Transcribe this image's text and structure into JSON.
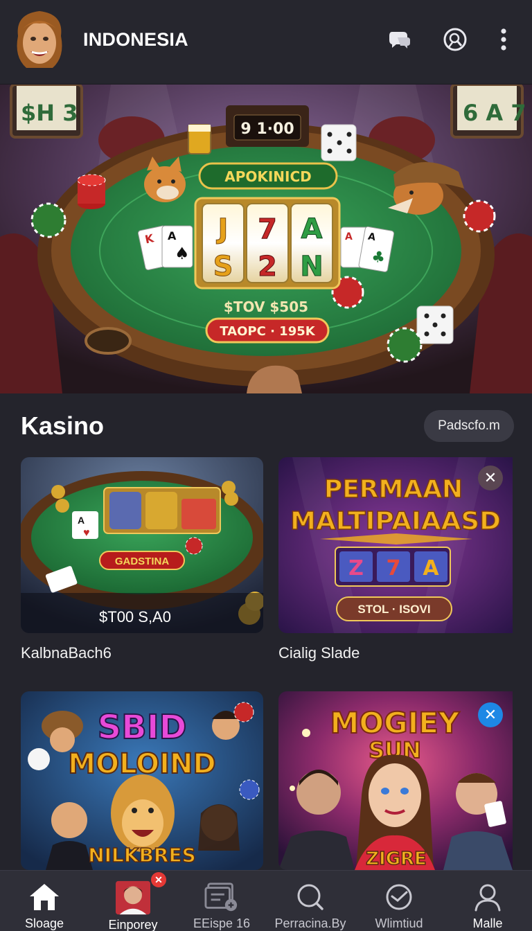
{
  "header": {
    "title": "INDONESIA",
    "icons": [
      "chat-icon",
      "search-icon",
      "more-vertical-icon"
    ]
  },
  "hero": {
    "timer": "9 1·00",
    "banner": "APOKINICD",
    "reels": [
      "J",
      "7",
      "A",
      "S",
      "2",
      "N"
    ],
    "pot_text": "$TOV  $505",
    "button": "TAOPC · 195K",
    "sign_left": "$H 3",
    "sign_right": "6 A 7"
  },
  "section": {
    "title": "Kasino",
    "pill": "Padscfo.m"
  },
  "cards": [
    {
      "title": "KalbnaBach6",
      "banner": "GADSTINA",
      "value": "$T00 S,A0"
    },
    {
      "title": "Cialig Slade",
      "headline_1": "PERMAAN",
      "headline_2": "MALTIPAIAASD",
      "reels": [
        "Z",
        "7",
        "A"
      ],
      "button": "STOL · ISOVI",
      "close": "✕"
    },
    {
      "headline_1": "SBID",
      "headline_2": "MOLOIND",
      "footer": "NILKBRES"
    },
    {
      "headline_1": "MOGIEY",
      "headline_2": "SUN",
      "footer": "ZIGRE",
      "close": "✕"
    }
  ],
  "bottom_nav": {
    "items": [
      {
        "label": "Sloage",
        "icon": "home-icon"
      },
      {
        "label": "Einporey",
        "icon": "profile-avatar-icon",
        "badge": "✕"
      },
      {
        "label": "EEispe 16",
        "icon": "cards-add-icon"
      },
      {
        "label": "Perracina.By",
        "icon": "search-icon"
      },
      {
        "label": "Wlimtiud",
        "icon": "clock-icon"
      },
      {
        "label": "Malle",
        "icon": "user-icon"
      }
    ]
  },
  "colors": {
    "background": "#24242c",
    "felt": "#2e8f4a",
    "accent_gold": "#f2b01e",
    "badge_blue": "#1e88e5",
    "badge_red": "#e53935"
  }
}
